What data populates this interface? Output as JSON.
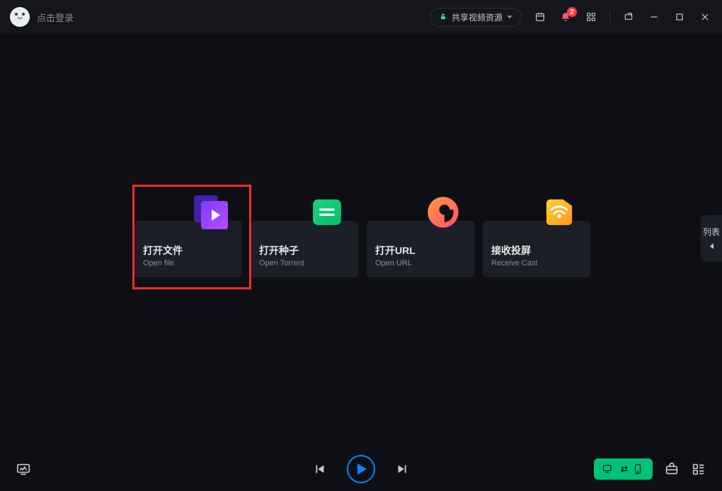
{
  "header": {
    "login_text": "点击登录",
    "share_label": "共享视频资源",
    "notif_count": "2"
  },
  "cards": {
    "open_file": {
      "title": "打开文件",
      "sub": "Open file"
    },
    "open_torrent": {
      "title": "打开种子",
      "sub": "Open Torrent"
    },
    "open_url": {
      "title": "打开URL",
      "sub": "Open URL"
    },
    "receive_cast": {
      "title": "接收投屏",
      "sub": "Receive Cast"
    }
  },
  "sidebar": {
    "playlist_label": "列表"
  }
}
